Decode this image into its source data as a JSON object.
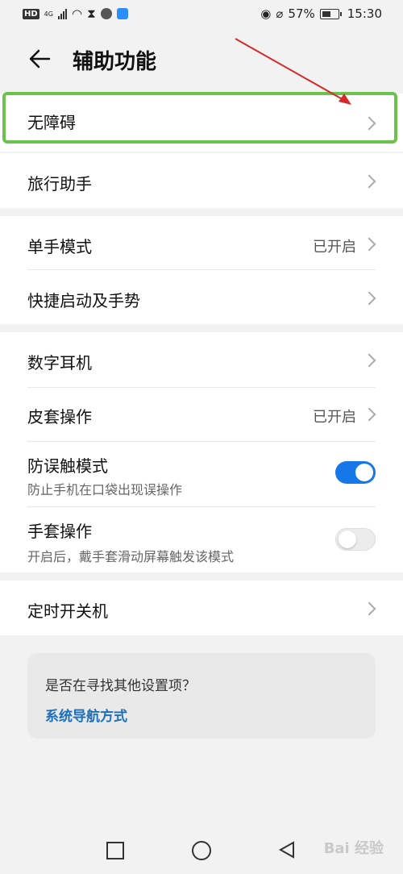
{
  "status_bar": {
    "left_badge": "HD",
    "network": "4G",
    "battery": "57%",
    "time": "15:30"
  },
  "header": {
    "title": "辅助功能",
    "back_icon": "arrow-left-icon"
  },
  "groups": [
    {
      "items": [
        {
          "label": "无障碍",
          "highlighted": true
        }
      ]
    },
    {
      "items": [
        {
          "label": "旅行助手"
        }
      ]
    },
    {
      "items": [
        {
          "label": "单手模式",
          "value": "已开启"
        },
        {
          "label": "快捷启动及手势"
        }
      ]
    },
    {
      "items": [
        {
          "label": "数字耳机"
        },
        {
          "label": "皮套操作",
          "value": "已开启"
        },
        {
          "label": "防误触模式",
          "sub": "防止手机在口袋出现误操作",
          "toggle": "on"
        },
        {
          "label": "手套操作",
          "sub": "开启后，戴手套滑动屏幕触发该模式",
          "toggle": "off"
        }
      ]
    },
    {
      "items": [
        {
          "label": "定时开关机"
        }
      ]
    }
  ],
  "suggestion": {
    "question": "是否在寻找其他设置项？",
    "link": "系统导航方式"
  },
  "watermark": "Bai 经验",
  "colors": {
    "accent": "#1677e8",
    "highlight": "#6cc24a",
    "arrow": "#d42a2a",
    "link": "#1d6fb8"
  }
}
